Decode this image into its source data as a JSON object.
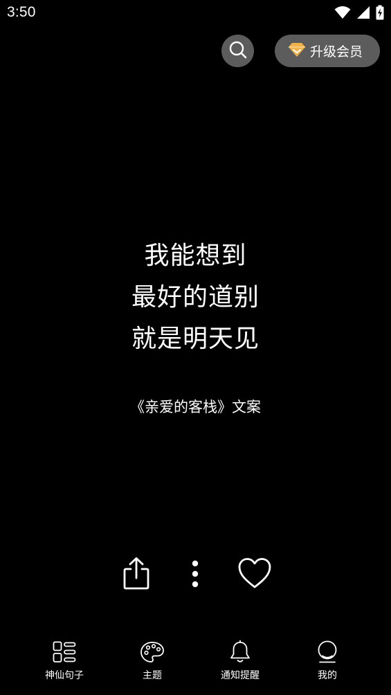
{
  "status_bar": {
    "time": "3:50",
    "icons": [
      "wifi-icon",
      "cell-signal-icon",
      "battery-charging-icon"
    ]
  },
  "header": {
    "search_icon": "search-icon",
    "vip_button_label": "升级会员",
    "vip_icon": "diamond-icon"
  },
  "quote": {
    "lines": [
      "我能想到",
      "最好的道别",
      "就是明天见"
    ],
    "source": "《亲爱的客栈》文案"
  },
  "actions": {
    "share_icon": "share-icon",
    "more_icon": "more-vertical-icon",
    "like_icon": "heart-icon"
  },
  "bottom_nav": {
    "items": [
      {
        "label": "神仙句子",
        "icon": "list-grid-icon"
      },
      {
        "label": "主题",
        "icon": "palette-icon"
      },
      {
        "label": "通知提醒",
        "icon": "bell-icon"
      },
      {
        "label": "我的",
        "icon": "profile-icon"
      }
    ]
  },
  "colors": {
    "background": "#000000",
    "button_bg": "#5c5c5c",
    "text": "#ffffff",
    "diamond_gold": "#f0b24a"
  }
}
